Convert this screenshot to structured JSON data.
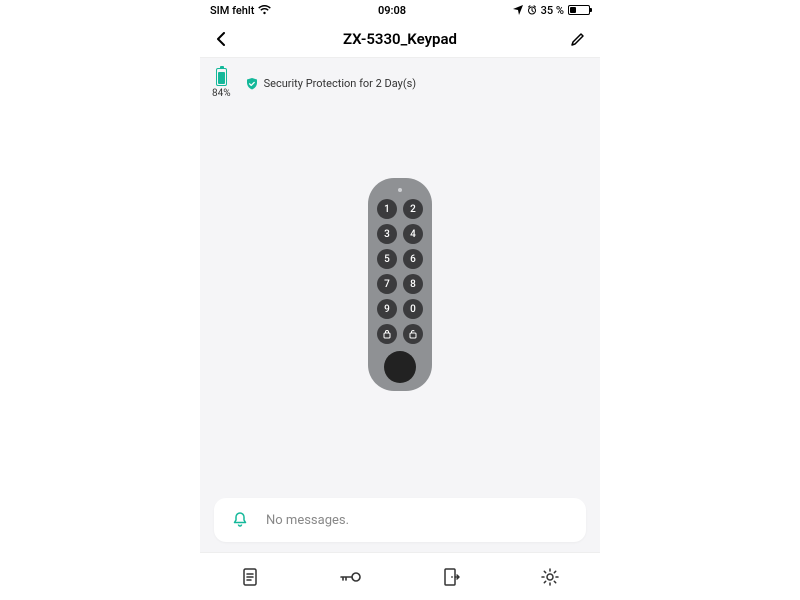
{
  "status_bar": {
    "carrier": "SIM fehlt",
    "time": "09:08",
    "battery_text": "35 %",
    "battery_level": 35
  },
  "header": {
    "title": "ZX-5330_Keypad"
  },
  "device": {
    "battery_pct_text": "84%",
    "battery_level": 84,
    "protection_text": "Security Protection for 2 Day(s)"
  },
  "keypad": {
    "rows": [
      [
        "1",
        "2"
      ],
      [
        "3",
        "4"
      ],
      [
        "5",
        "6"
      ],
      [
        "7",
        "8"
      ],
      [
        "9",
        "0"
      ]
    ]
  },
  "messages": {
    "text": "No messages."
  },
  "colors": {
    "accent": "#14b89a"
  }
}
